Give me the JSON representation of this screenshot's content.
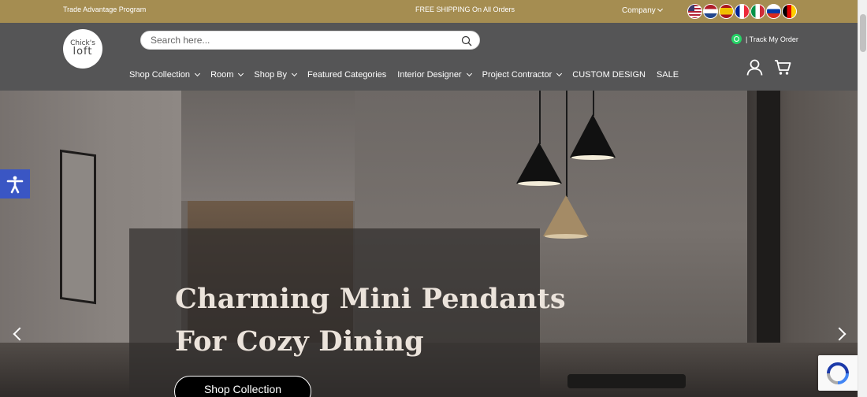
{
  "topbar": {
    "trade_program": "Trade Advantage Program",
    "shipping_notice": "FREE SHIPPING On All Orders",
    "company_menu": "Company",
    "flags": [
      "us-flag-icon",
      "netherlands-flag-icon",
      "spain-flag-icon",
      "france-flag-icon",
      "italy-flag-icon",
      "russia-flag-icon",
      "germany-flag-icon"
    ]
  },
  "header": {
    "logo_line1": "Chick's",
    "logo_line2": "loft",
    "search_placeholder": "Search here...",
    "track_order": "| Track My Order"
  },
  "nav": [
    {
      "label": "Shop Collection",
      "dropdown": true
    },
    {
      "label": "Room",
      "dropdown": true
    },
    {
      "label": "Shop By",
      "dropdown": true
    },
    {
      "label": "Featured Categories",
      "dropdown": false
    },
    {
      "label": "Interior Designer",
      "dropdown": true
    },
    {
      "label": "Project Contractor",
      "dropdown": true
    },
    {
      "label": "CUSTOM DESIGN",
      "dropdown": false
    },
    {
      "label": "SALE",
      "dropdown": false
    }
  ],
  "hero": {
    "headline_line1": "Charming Mini Pendants",
    "headline_line2": "For Cozy Dining",
    "cta_label": "Shop Collection"
  },
  "colors": {
    "topbar": "#a58d51",
    "header": "#555556",
    "accessibility": "#3a56c4"
  }
}
